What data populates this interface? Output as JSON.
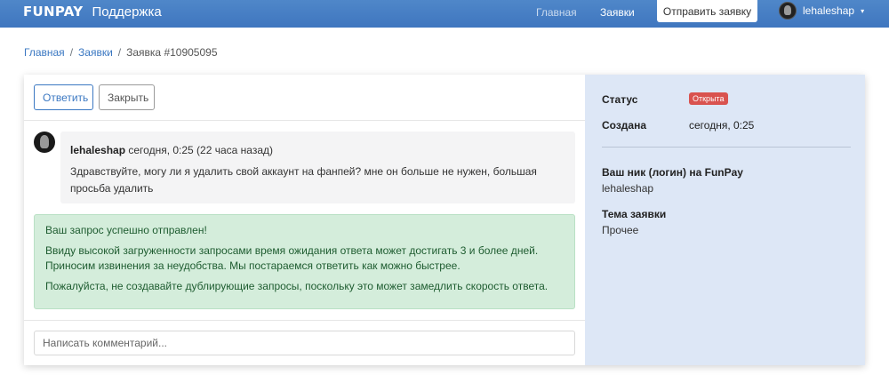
{
  "header": {
    "logo_text": "FUNPAY",
    "subtitle": "Поддержка",
    "nav": {
      "home": "Главная",
      "tickets": "Заявки",
      "submit": "Отправить заявку"
    },
    "user": {
      "name": "lehaleshap",
      "avatar_icon": "knight-helmet-avatar",
      "caret": "▾"
    }
  },
  "breadcrumb": {
    "home": "Главная",
    "sep1": "/",
    "tickets": "Заявки",
    "sep2": "/",
    "current": "Заявка #10905095"
  },
  "actions": {
    "reply": "Ответить",
    "close": "Закрыть"
  },
  "message": {
    "author": "lehaleshap",
    "time": "сегодня, 0:25 (22 часа назад)",
    "text": "Здравствуйте, могу ли я удалить свой аккаунт на фанпей? мне он больше не нужен, большая просьба удалить"
  },
  "alert": {
    "line1": "Ваш запрос успешно отправлен!",
    "line2": "Ввиду высокой загруженности запросами время ожидания ответа может достигать 3 и более дней. Приносим извинения за неудобства. Мы постараемся ответить как можно быстрее.",
    "line3": "Пожалуйста, не создавайте дублирующие запросы, поскольку это может замедлить скорость ответа."
  },
  "comment": {
    "placeholder": "Написать комментарий..."
  },
  "sidebar": {
    "status_label": "Статус",
    "status_value": "Открыта",
    "created_label": "Создана",
    "created_value": "сегодня, 0:25",
    "nick_label": "Ваш ник (логин) на FunPay",
    "nick_value": "lehaleshap",
    "topic_label": "Тема заявки",
    "topic_value": "Прочее"
  },
  "colors": {
    "navbar": "#4f87c9",
    "badge": "#d9534f",
    "alert_bg": "#d4eddb",
    "sidebar_bg": "#dde7f6"
  }
}
